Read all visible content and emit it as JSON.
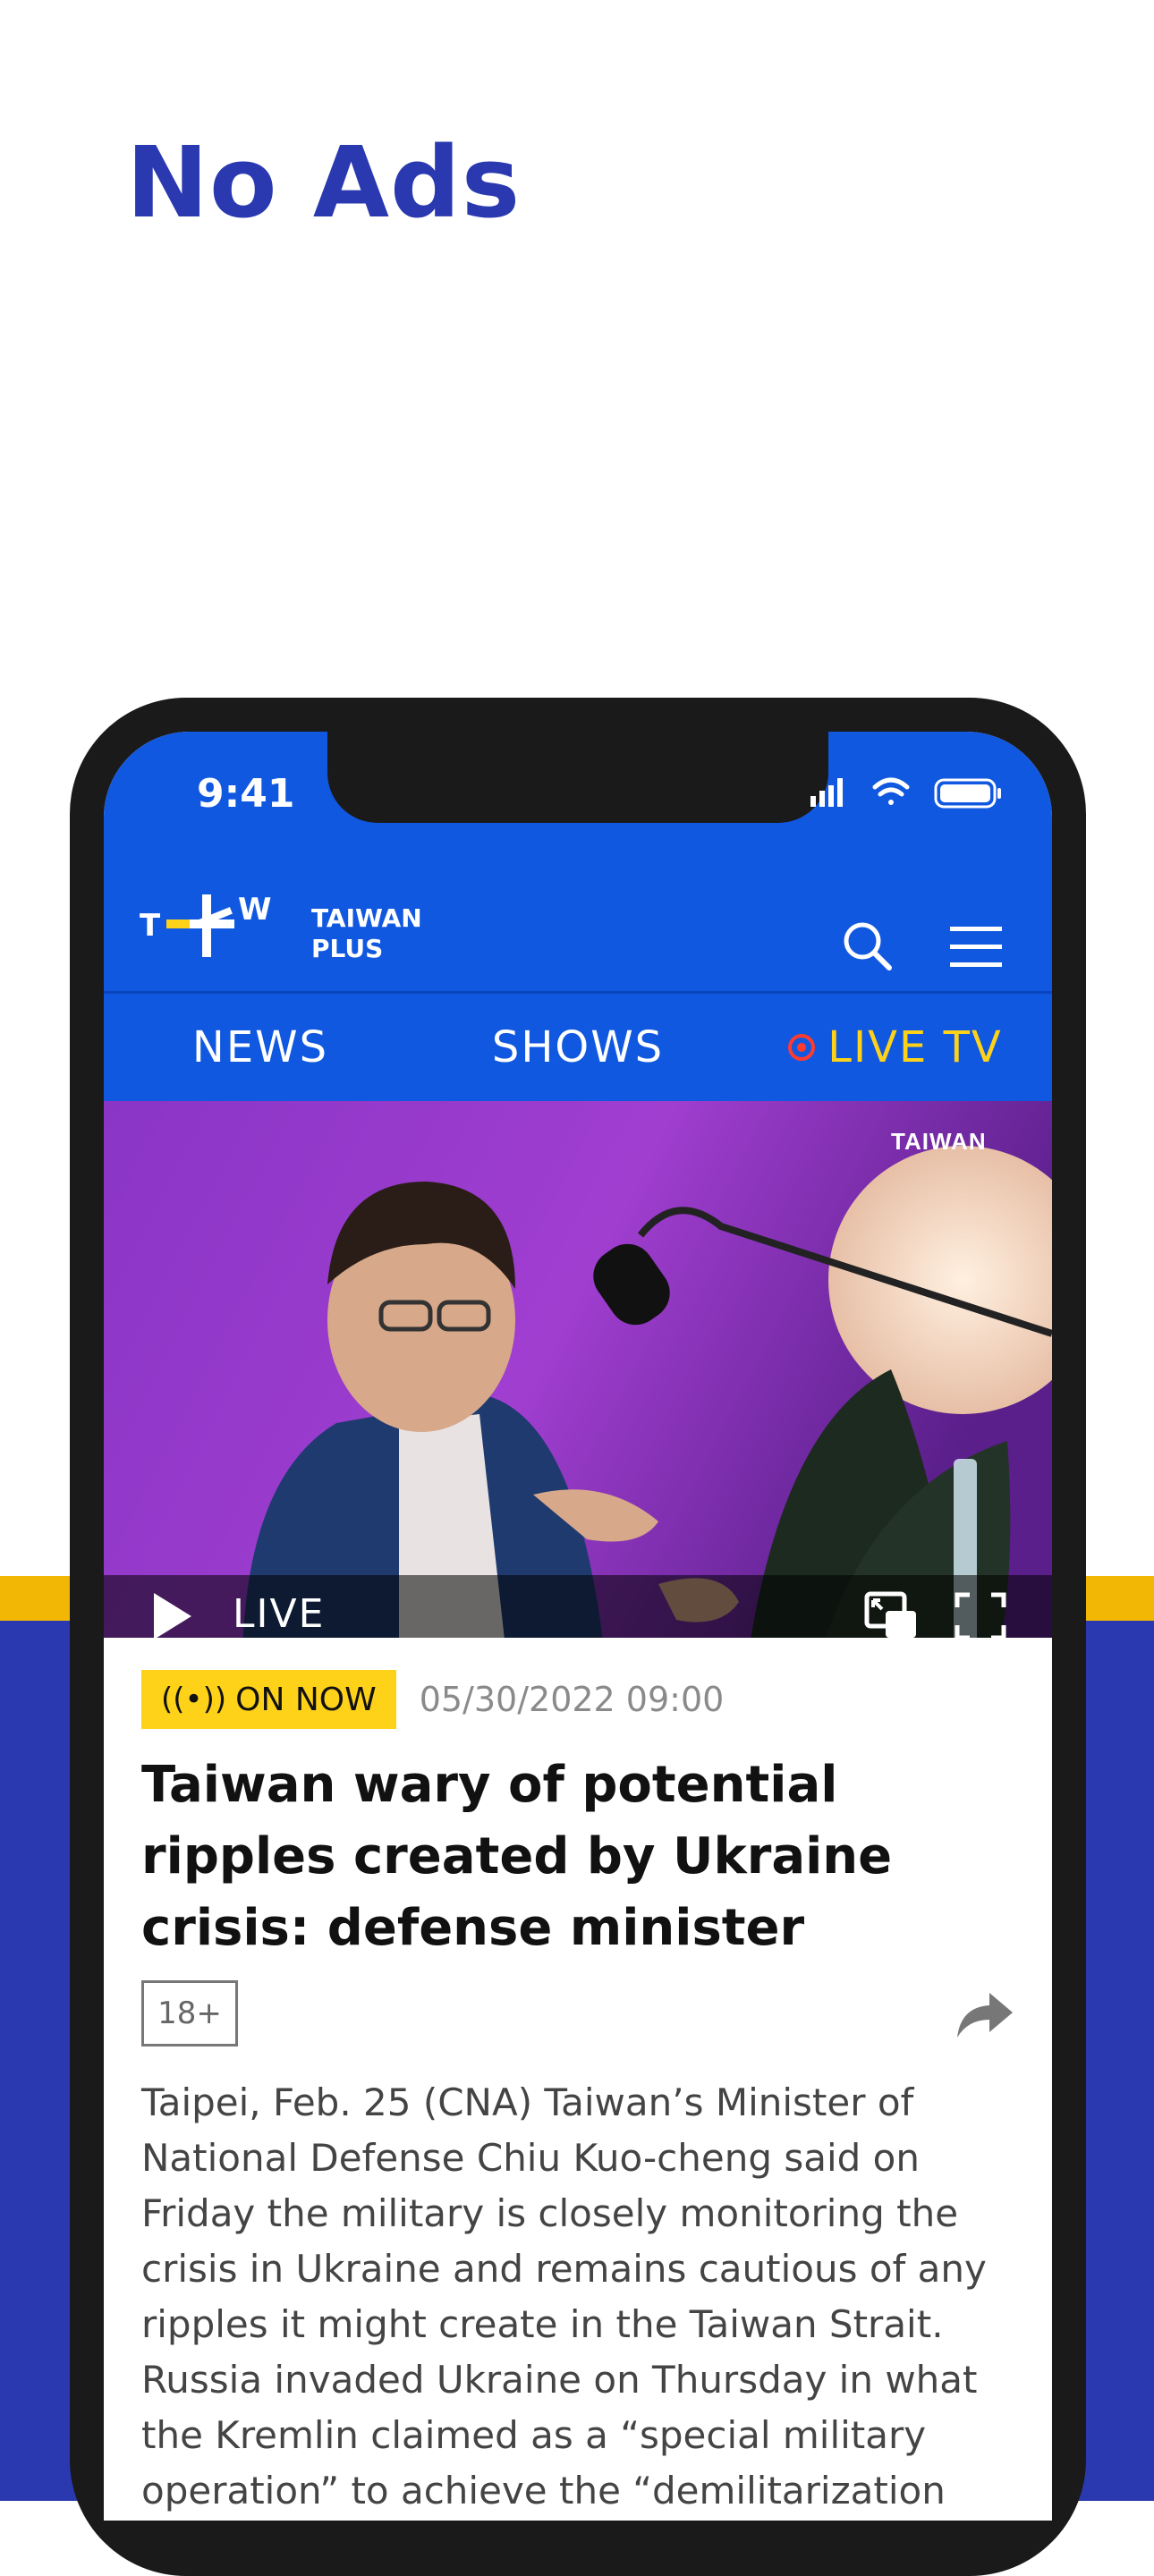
{
  "promo": {
    "headline": "No Ads"
  },
  "status_bar": {
    "time": "9:41"
  },
  "header": {
    "logo_letters": {
      "left": "T",
      "right": "W"
    },
    "brand_line1": "TAIWAN",
    "brand_line2": "PLUS"
  },
  "nav": {
    "tabs": [
      {
        "label": "NEWS"
      },
      {
        "label": "SHOWS"
      },
      {
        "label": "LIVE TV",
        "active": true
      }
    ]
  },
  "player": {
    "live_label": "LIVE",
    "channel_logo": "TAIWAN"
  },
  "article": {
    "badge": "ON NOW",
    "date": "05/30/2022 09:00",
    "title": "Taiwan wary of potential ripples created by Ukraine crisis: defense minister",
    "rating": "18+",
    "body_p1": "Taipei, Feb. 25 (CNA) Taiwan’s Minister of National Defense Chiu Kuo-cheng said on Friday the military is closely monitoring the crisis in Ukraine and remains cautious of any ripples it might create in the Taiwan Strait.",
    "body_p2": "Russia invaded Ukraine on Thursday in what the Kremlin claimed as a “special military operation” to achieve the “demilitarization and"
  },
  "colors": {
    "brand_blue": "#1158e0",
    "promo_blue": "#2a39b0",
    "accent_yellow": "#ffd21a",
    "stripe_yellow": "#f2b705",
    "live_red": "#ff3b30"
  }
}
